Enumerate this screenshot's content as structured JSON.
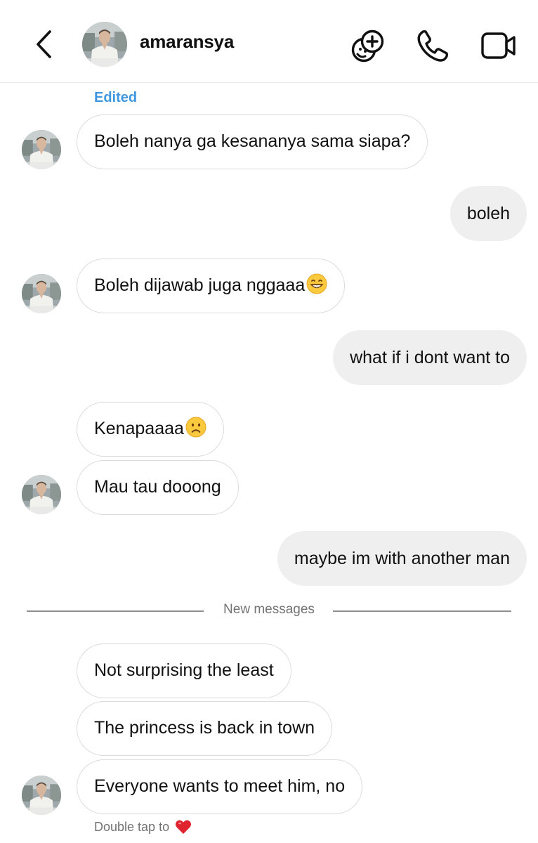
{
  "header": {
    "contact_name": "amaransya",
    "icons": [
      "back-chevron-icon",
      "effects-face-add-icon",
      "phone-call-icon",
      "video-call-icon"
    ]
  },
  "conversation": {
    "edited_label": "Edited",
    "messages": [
      {
        "direction": "incoming",
        "text": "Boleh nanya ga kesananya sama siapa?"
      },
      {
        "direction": "outgoing",
        "text": "boleh"
      },
      {
        "direction": "incoming",
        "text": "Boleh dijawab juga nggaaa",
        "emoji": "grinning-face"
      },
      {
        "direction": "outgoing",
        "text": "what if i dont want to"
      },
      {
        "direction": "incoming",
        "text": "Kenapaaaa",
        "emoji": "frowning-face"
      },
      {
        "direction": "incoming",
        "text": "Mau tau dooong"
      },
      {
        "direction": "outgoing",
        "text": "maybe im with another man"
      },
      {
        "direction": "incoming",
        "text": "Not surprising the least"
      },
      {
        "direction": "incoming",
        "text": "The princess is back in town"
      },
      {
        "direction": "incoming",
        "text": "Everyone wants to meet him, no"
      }
    ],
    "divider_label": "New messages",
    "double_tap_hint": "Double tap to"
  },
  "colors": {
    "edited": "#3f97e0",
    "outgoing_bubble": "#efefef",
    "incoming_border": "#dbdbdb",
    "heart": "#e0242f"
  }
}
